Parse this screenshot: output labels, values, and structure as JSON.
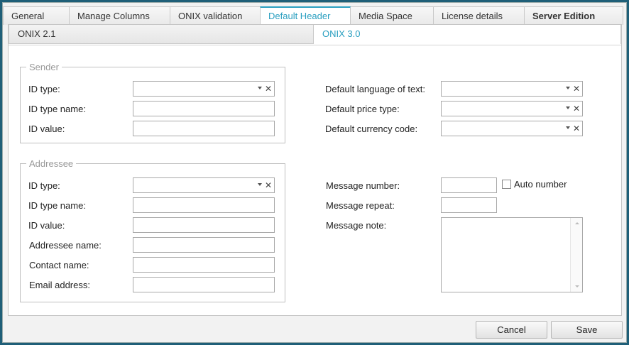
{
  "tabs": [
    {
      "label": "General"
    },
    {
      "label": "Manage Columns"
    },
    {
      "label": "ONIX validation"
    },
    {
      "label": "Default Header"
    },
    {
      "label": "Media Space"
    },
    {
      "label": "License details"
    },
    {
      "label": "Server Edition"
    }
  ],
  "subtabs": [
    {
      "label": "ONIX 2.1"
    },
    {
      "label": "ONIX 3.0"
    }
  ],
  "sender": {
    "legend": "Sender",
    "id_type_label": "ID type:",
    "id_type_value": "",
    "id_type_name_label": "ID type name:",
    "id_type_name_value": "",
    "id_value_label": "ID value:",
    "id_value_value": ""
  },
  "addressee": {
    "legend": "Addressee",
    "id_type_label": "ID type:",
    "id_type_value": "",
    "id_type_name_label": "ID type name:",
    "id_type_name_value": "",
    "id_value_label": "ID value:",
    "id_value_value": "",
    "addressee_name_label": "Addressee name:",
    "addressee_name_value": "",
    "contact_name_label": "Contact name:",
    "contact_name_value": "",
    "email_label": "Email address:",
    "email_value": ""
  },
  "defaults": {
    "language_label": "Default language of text:",
    "language_value": "",
    "price_type_label": "Default price type:",
    "price_type_value": "",
    "currency_label": "Default currency code:",
    "currency_value": ""
  },
  "message": {
    "number_label": "Message number:",
    "number_value": "",
    "auto_number_label": "Auto number",
    "auto_number_checked": false,
    "repeat_label": "Message repeat:",
    "repeat_value": "",
    "note_label": "Message note:",
    "note_value": ""
  },
  "icons": {
    "dropdown": "chevron-down-icon",
    "clear": "clear-x-icon"
  },
  "colors": {
    "accent": "#2a9fc0",
    "window_frame": "#1f5f78"
  },
  "buttons": {
    "cancel": "Cancel",
    "save": "Save"
  }
}
